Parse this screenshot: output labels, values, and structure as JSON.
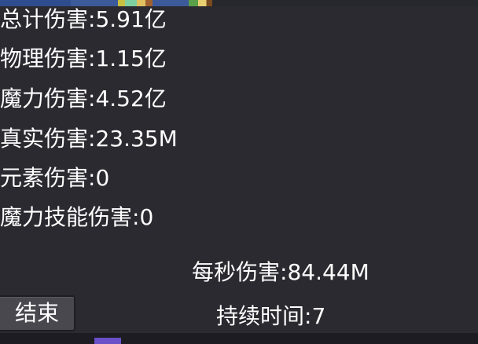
{
  "stats": [
    {
      "label": "总计伤害:",
      "value": "5.91亿"
    },
    {
      "label": "物理伤害:",
      "value": "1.15亿"
    },
    {
      "label": "魔力伤害:",
      "value": "4.52亿"
    },
    {
      "label": "真实伤害:",
      "value": "23.35M"
    },
    {
      "label": "元素伤害:",
      "value": "0"
    },
    {
      "label": "魔力技能伤害:",
      "value": "0"
    }
  ],
  "dps": {
    "label": "每秒伤害:",
    "value": "84.44M"
  },
  "duration": {
    "label": "持续时间:",
    "value": "7"
  },
  "end_button": {
    "label": "结束"
  },
  "colors": {
    "panel_bg": "#2a2a30",
    "text": "#ffffff",
    "button_bg": "#48484e"
  }
}
